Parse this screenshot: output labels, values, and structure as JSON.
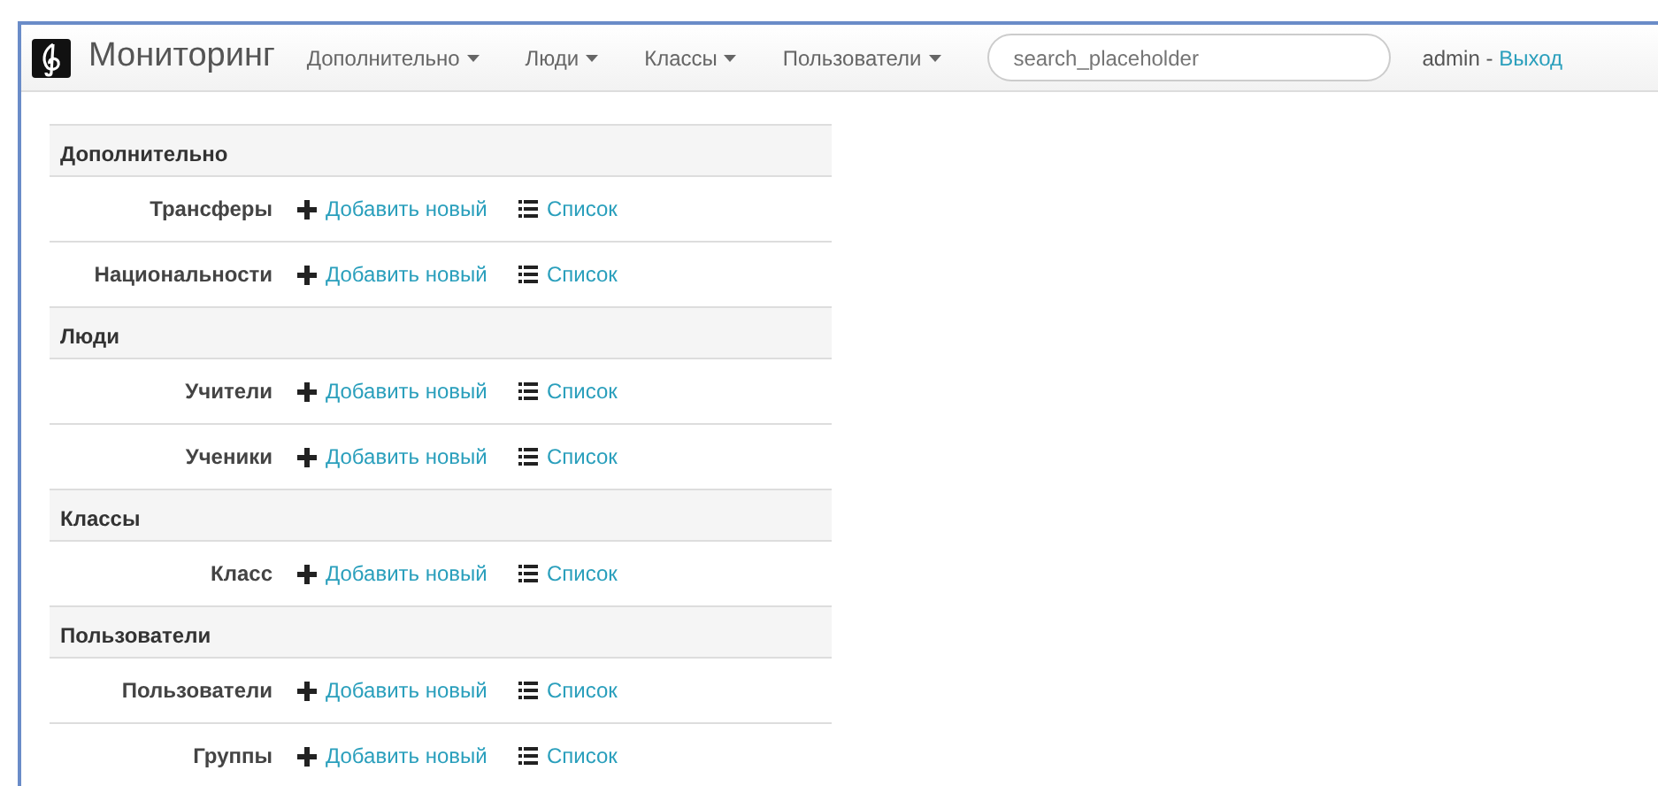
{
  "navbar": {
    "brand": "Мониторинг",
    "menus": [
      {
        "label": "Дополнительно"
      },
      {
        "label": "Люди"
      },
      {
        "label": "Классы"
      },
      {
        "label": "Пользователи"
      }
    ],
    "search": {
      "placeholder": "search_placeholder"
    },
    "user": "admin",
    "separator": "-",
    "logout": "Выход"
  },
  "sections": [
    {
      "title": "Дополнительно",
      "items": [
        {
          "name": "Трансферы",
          "add": "Добавить новый",
          "list": "Список"
        },
        {
          "name": "Национальности",
          "add": "Добавить новый",
          "list": "Список"
        }
      ]
    },
    {
      "title": "Люди",
      "items": [
        {
          "name": "Учители",
          "add": "Добавить новый",
          "list": "Список"
        },
        {
          "name": "Ученики",
          "add": "Добавить новый",
          "list": "Список"
        }
      ]
    },
    {
      "title": "Классы",
      "items": [
        {
          "name": "Класс",
          "add": "Добавить новый",
          "list": "Список"
        }
      ]
    },
    {
      "title": "Пользователи",
      "items": [
        {
          "name": "Пользователи",
          "add": "Добавить новый",
          "list": "Список"
        },
        {
          "name": "Группы",
          "add": "Добавить новый",
          "list": "Список"
        }
      ]
    }
  ]
}
